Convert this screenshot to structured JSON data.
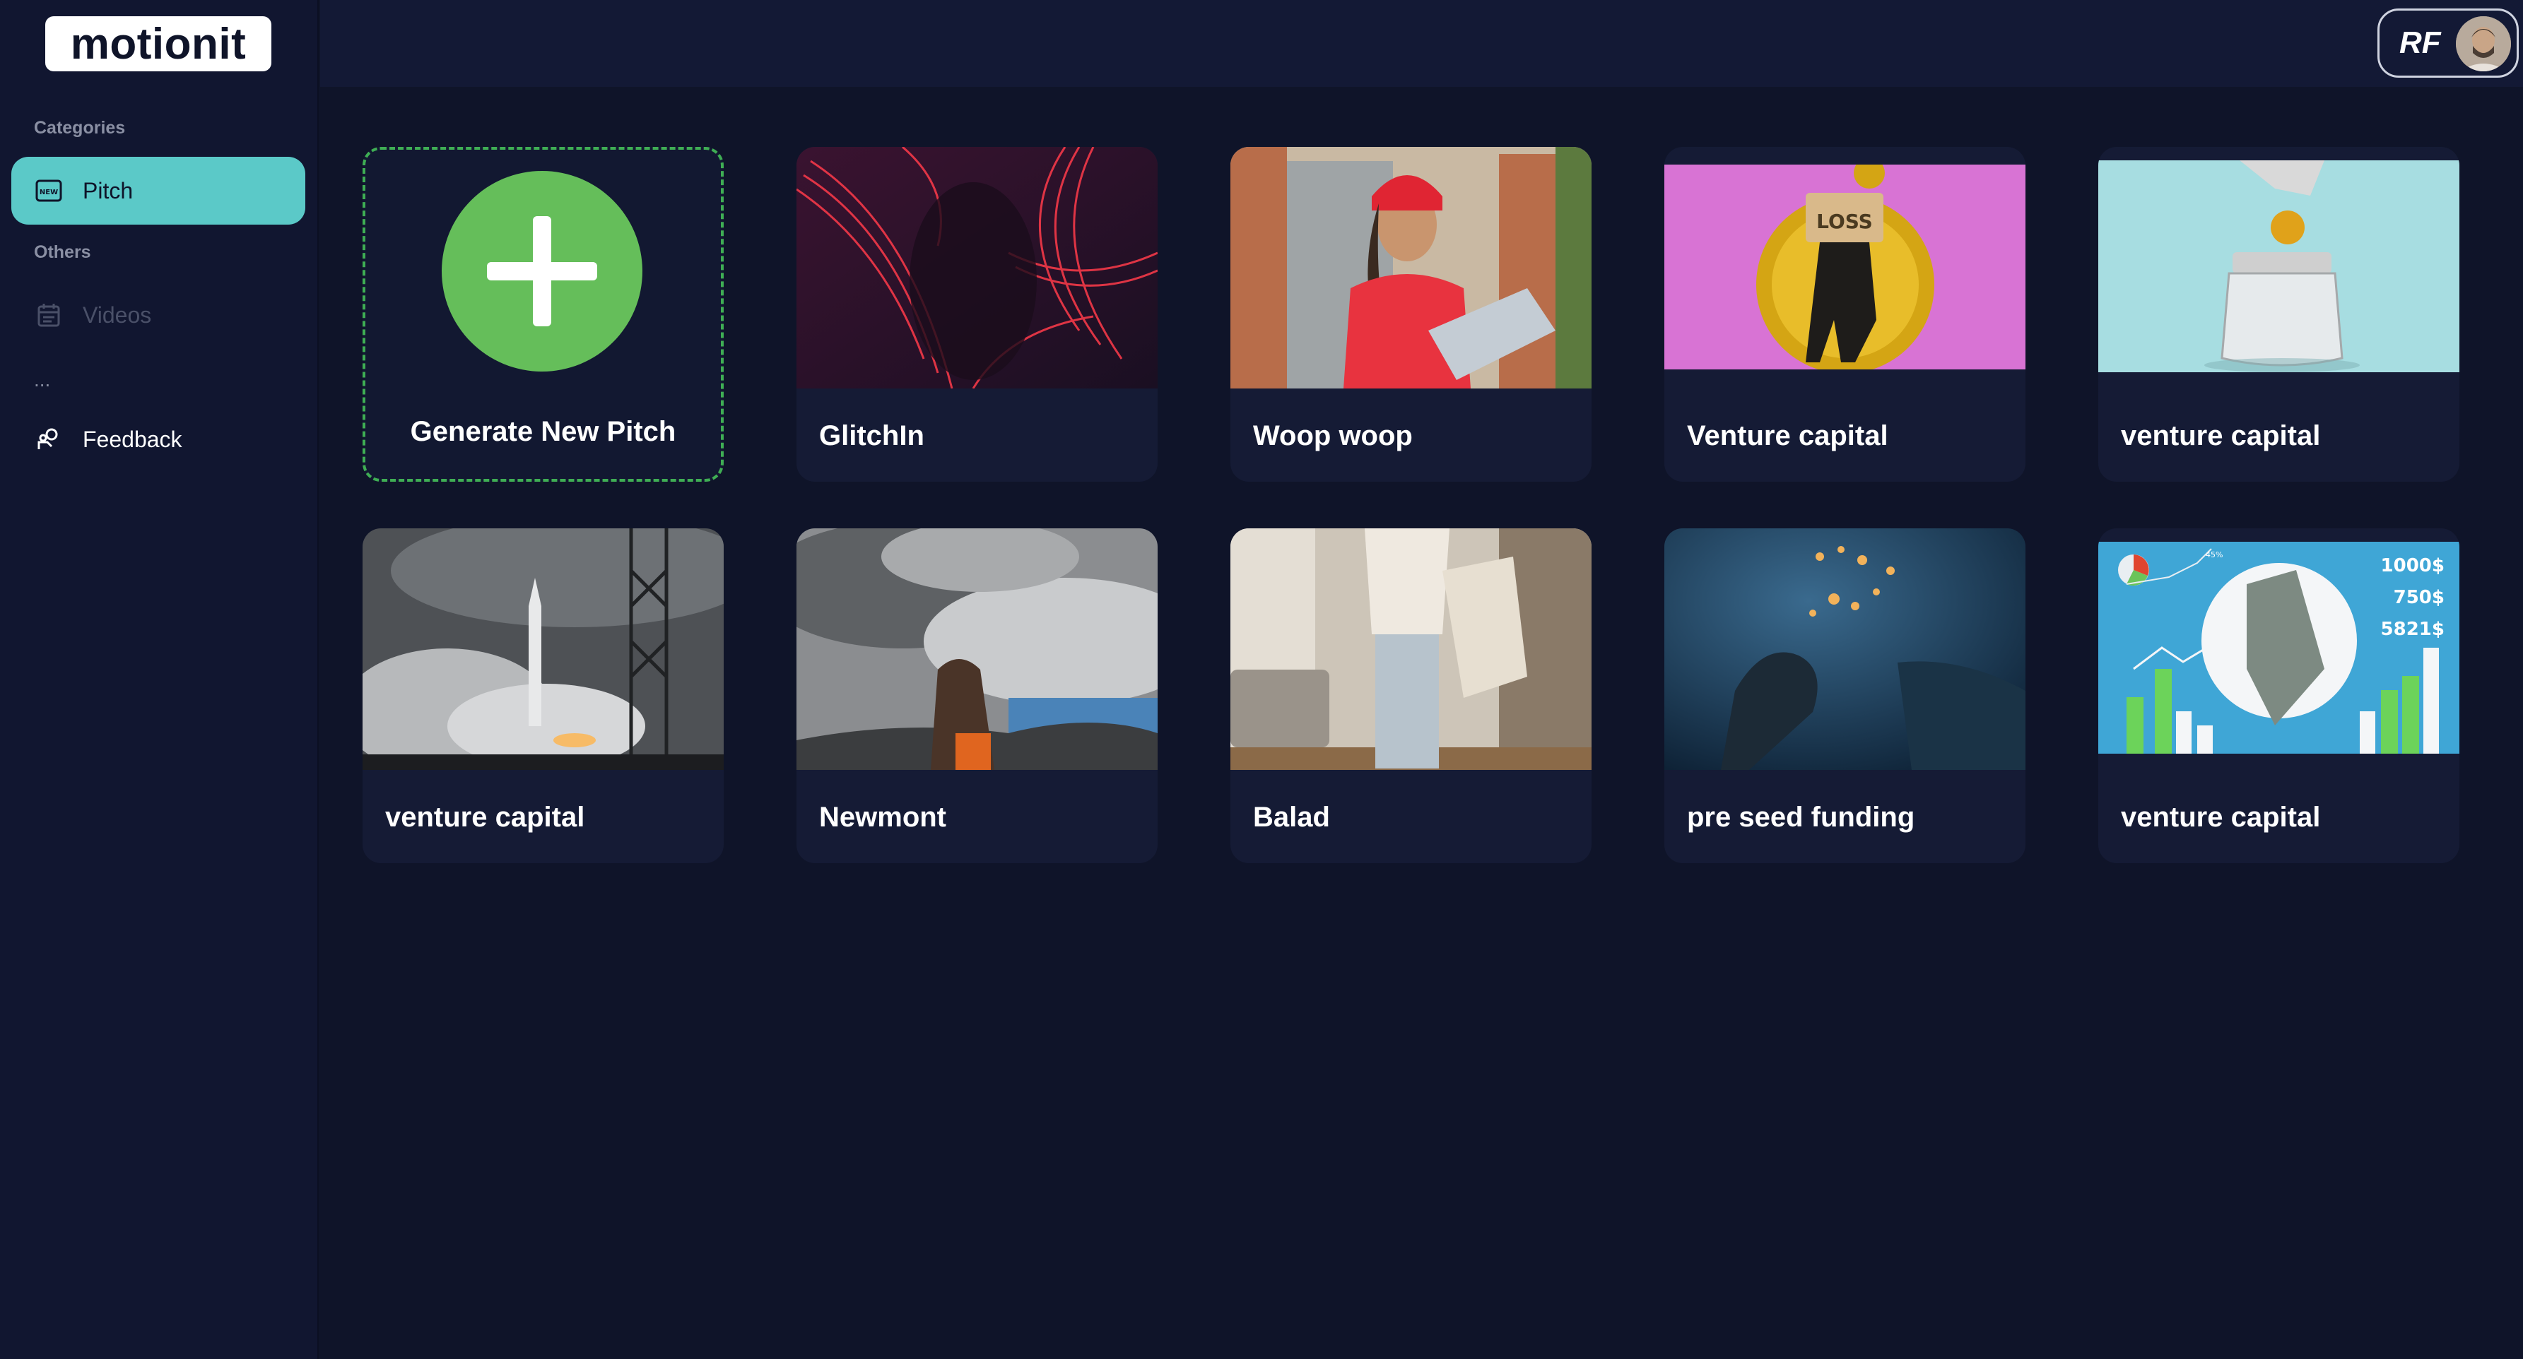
{
  "app": {
    "logo": "motionit"
  },
  "sidebar": {
    "categories_label": "Categories",
    "pitch_label": "Pitch",
    "others_label": "Others",
    "videos_label": "Videos",
    "ellipsis": "...",
    "feedback_label": "Feedback",
    "icons": {
      "pitch": "new-badge-icon",
      "videos": "calendar-icon",
      "feedback": "feedback-icon"
    }
  },
  "header": {
    "profile_initials": "RF"
  },
  "cards": [
    {
      "title": "Generate New Pitch",
      "kind": "generate"
    },
    {
      "title": "GlitchIn"
    },
    {
      "title": "Woop woop"
    },
    {
      "title": "Venture capital"
    },
    {
      "title": "venture capital"
    },
    {
      "title": "venture capital"
    },
    {
      "title": "Newmont"
    },
    {
      "title": "Balad"
    },
    {
      "title": "pre seed funding"
    },
    {
      "title": "venture capital"
    }
  ],
  "chart_overlay": {
    "values": [
      "1000$",
      "750$",
      "5821$"
    ],
    "pct": "45%"
  },
  "colors": {
    "accent": "#5bc9c8",
    "generate": "#65be5a",
    "bg": "#0f1429"
  }
}
